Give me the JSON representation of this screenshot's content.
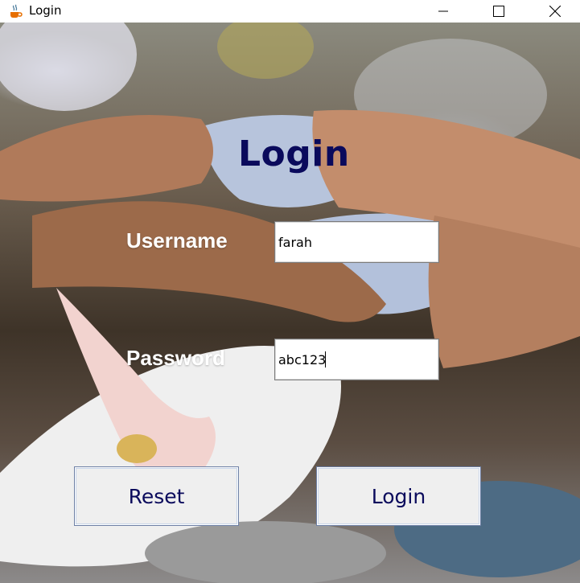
{
  "window": {
    "title": "Login",
    "icon": "java-cup-icon",
    "controls": [
      "minimize-icon",
      "maximize-icon",
      "close-icon"
    ]
  },
  "form": {
    "heading": "Login",
    "username_label": "Username",
    "username_value": "farah",
    "password_label": "Password",
    "password_value": "abc123",
    "reset_label": "Reset",
    "login_label": "Login"
  },
  "colors": {
    "heading": "#0a0a5c",
    "button_text": "#0a0a5c",
    "label_text": "#ffffff",
    "button_bg": "#efefef"
  }
}
